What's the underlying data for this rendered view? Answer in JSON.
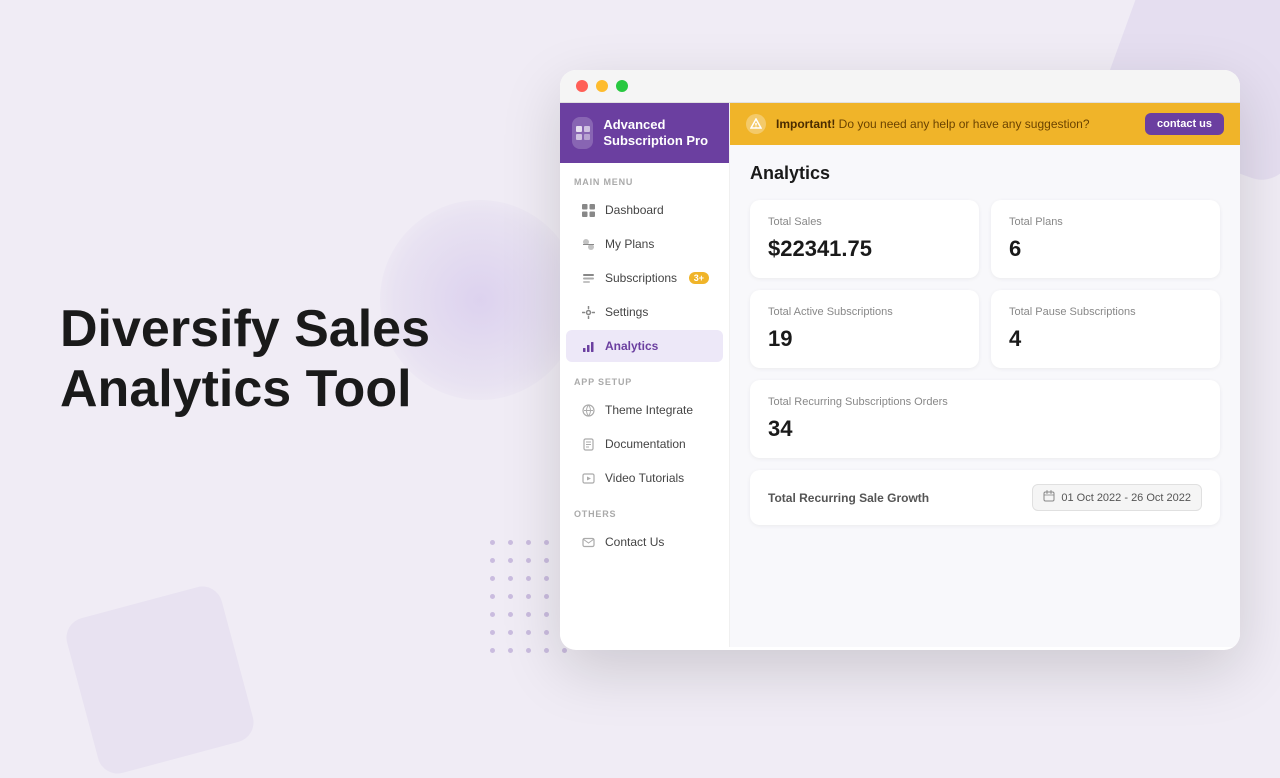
{
  "background": {
    "title_line1": "Diversify Sales",
    "title_line2": "Analytics Tool"
  },
  "browser": {
    "dots": [
      "red",
      "yellow",
      "green"
    ]
  },
  "sidebar": {
    "logo": {
      "name": "Advanced Subscription Pro"
    },
    "main_menu_label": "MAIN MENU",
    "items": [
      {
        "id": "dashboard",
        "label": "Dashboard",
        "icon": "🏠",
        "active": false
      },
      {
        "id": "my-plans",
        "label": "My Plans",
        "icon": "📋",
        "active": false
      },
      {
        "id": "subscriptions",
        "label": "Subscriptions",
        "icon": "🔄",
        "badge": "3+",
        "active": false
      },
      {
        "id": "settings",
        "label": "Settings",
        "icon": "⚙️",
        "active": false
      },
      {
        "id": "analytics",
        "label": "Analytics",
        "icon": "📊",
        "active": true
      }
    ],
    "app_setup_label": "APP SETUP",
    "setup_items": [
      {
        "id": "theme-integrate",
        "label": "Theme Integrate",
        "icon": "🎨"
      },
      {
        "id": "documentation",
        "label": "Documentation",
        "icon": "📄"
      },
      {
        "id": "video-tutorials",
        "label": "Video Tutorials",
        "icon": "🎬"
      }
    ],
    "others_label": "OTHERS",
    "other_items": [
      {
        "id": "contact-us",
        "label": "Contact Us",
        "icon": "📞"
      }
    ]
  },
  "banner": {
    "icon": "⚠️",
    "important_text": "Important!",
    "message": "Do you need any help or have any suggestion?",
    "button_label": "contact us"
  },
  "analytics": {
    "page_title": "Analytics",
    "stats": [
      {
        "label": "Total Sales",
        "value": "$22341.75"
      },
      {
        "label": "Total Plans",
        "value": "6"
      },
      {
        "label": "Total Active Subscriptions",
        "value": "19"
      },
      {
        "label": "Total Pause Subscriptions",
        "value": "4"
      }
    ],
    "recurring_orders": {
      "label": "Total Recurring Subscriptions Orders",
      "value": "34"
    },
    "growth": {
      "label": "Total Recurring Sale Growth",
      "date_range": "01 Oct 2022 - 26 Oct 2022"
    }
  }
}
